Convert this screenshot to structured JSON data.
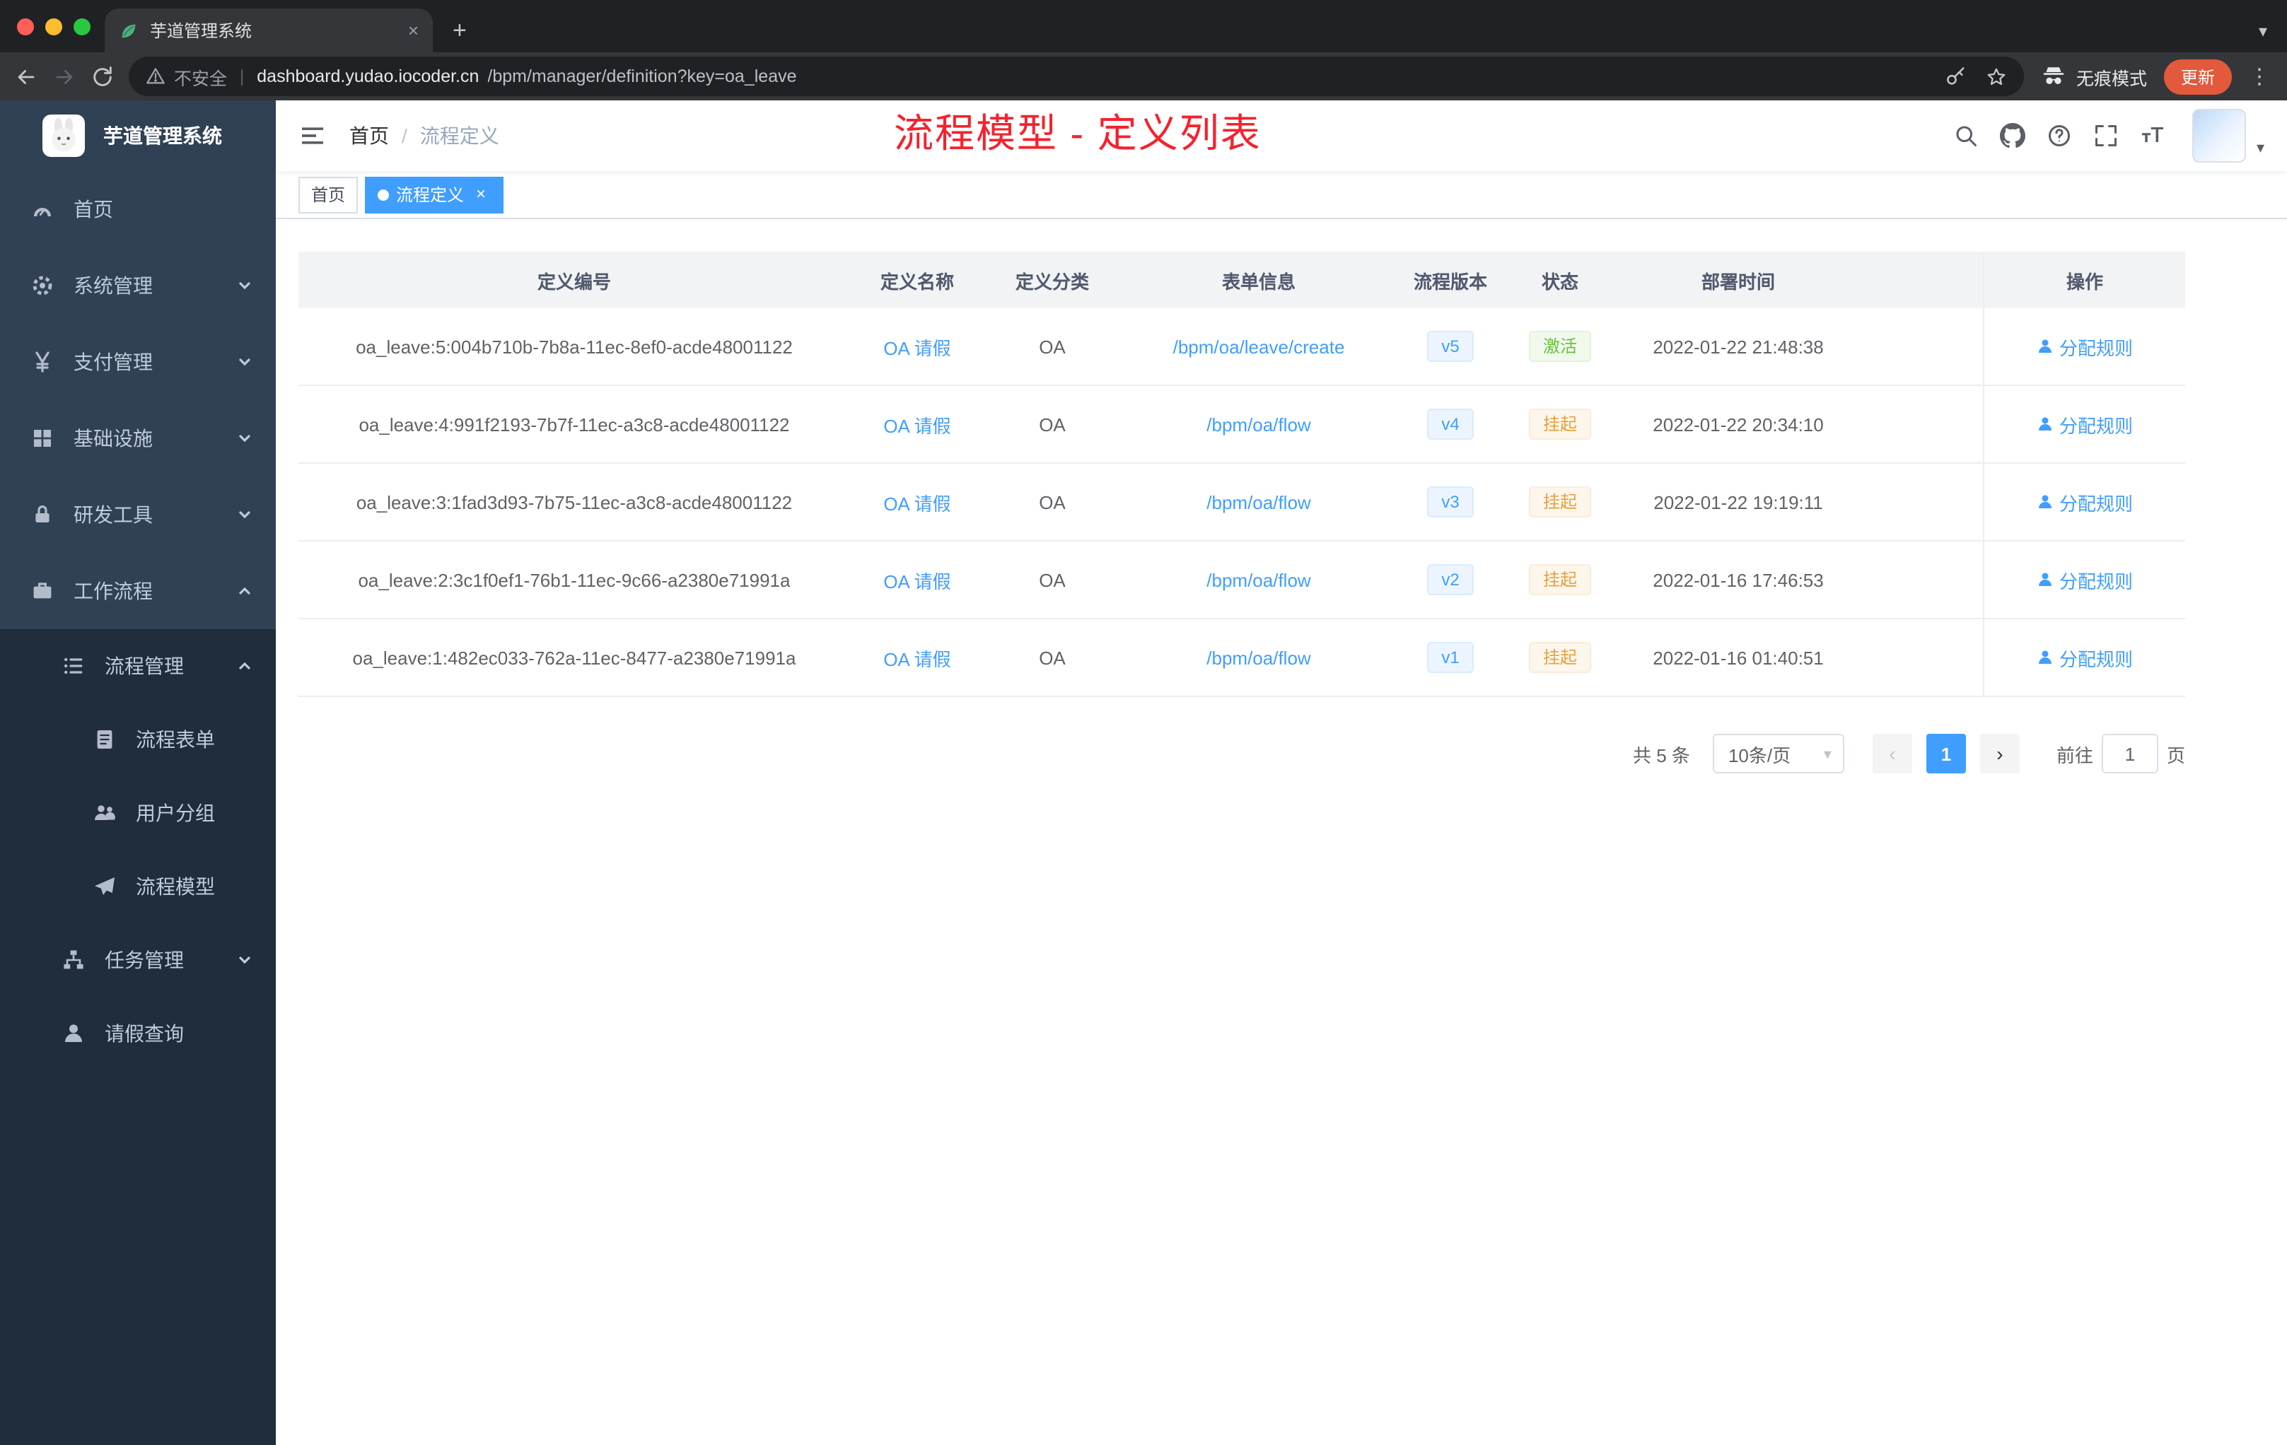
{
  "colors": {
    "accent": "#409eff",
    "success": "#67c23a",
    "warning": "#e6a23c",
    "annotation_red": "#f5222d",
    "sidebar_bg": "#304156",
    "sidebar_sub_bg": "#1f2d3d"
  },
  "icons": {
    "close": "×",
    "plus": "+",
    "caret_down": "▾",
    "more_vertical": "⋮",
    "prev": "‹",
    "next": "›",
    "url_divider": "|"
  },
  "browser": {
    "tab": {
      "title": "芋道管理系统"
    },
    "address": {
      "security_label": "不安全",
      "url_domain": "dashboard.yudao.iocoder.cn",
      "url_path": "/bpm/manager/definition?key=oa_leave",
      "incognito_label": "无痕模式",
      "update_label": "更新"
    }
  },
  "sidebar": {
    "app_title": "芋道管理系统",
    "items": [
      {
        "label": "首页"
      },
      {
        "label": "系统管理"
      },
      {
        "label": "支付管理"
      },
      {
        "label": "基础设施"
      },
      {
        "label": "研发工具"
      },
      {
        "label": "工作流程"
      }
    ],
    "submenu": {
      "manage": {
        "label": "流程管理"
      },
      "children": [
        {
          "label": "流程表单"
        },
        {
          "label": "用户分组"
        },
        {
          "label": "流程模型"
        }
      ],
      "task": {
        "label": "任务管理"
      },
      "leave": {
        "label": "请假查询"
      }
    }
  },
  "header": {
    "breadcrumb": {
      "home": "首页",
      "separator": "/",
      "current": "流程定义"
    },
    "annotation": "流程模型 - 定义列表"
  },
  "tags": {
    "items": [
      {
        "label": "首页",
        "active": false
      },
      {
        "label": "流程定义",
        "active": true
      }
    ]
  },
  "table": {
    "columns": [
      "定义编号",
      "定义名称",
      "定义分类",
      "表单信息",
      "流程版本",
      "状态",
      "部署时间",
      "操作"
    ],
    "rows": [
      {
        "id": "oa_leave:5:004b710b-7b8a-11ec-8ef0-acde48001122",
        "name": "OA 请假",
        "category": "OA",
        "form": "/bpm/oa/leave/create",
        "version": "v5",
        "status": "激活",
        "deploy_time": "2022-01-22 21:48:38",
        "action": "分配规则"
      },
      {
        "id": "oa_leave:4:991f2193-7b7f-11ec-a3c8-acde48001122",
        "name": "OA 请假",
        "category": "OA",
        "form": "/bpm/oa/flow",
        "version": "v4",
        "status": "挂起",
        "deploy_time": "2022-01-22 20:34:10",
        "action": "分配规则"
      },
      {
        "id": "oa_leave:3:1fad3d93-7b75-11ec-a3c8-acde48001122",
        "name": "OA 请假",
        "category": "OA",
        "form": "/bpm/oa/flow",
        "version": "v3",
        "status": "挂起",
        "deploy_time": "2022-01-22 19:19:11",
        "action": "分配规则"
      },
      {
        "id": "oa_leave:2:3c1f0ef1-76b1-11ec-9c66-a2380e71991a",
        "name": "OA 请假",
        "category": "OA",
        "form": "/bpm/oa/flow",
        "version": "v2",
        "status": "挂起",
        "deploy_time": "2022-01-16 17:46:53",
        "action": "分配规则"
      },
      {
        "id": "oa_leave:1:482ec033-762a-11ec-8477-a2380e71991a",
        "name": "OA 请假",
        "category": "OA",
        "form": "/bpm/oa/flow",
        "version": "v1",
        "status": "挂起",
        "deploy_time": "2022-01-16 01:40:51",
        "action": "分配规则"
      }
    ]
  },
  "pagination": {
    "total": "共 5 条",
    "page_size": "10条/页",
    "prev": "‹",
    "page": "1",
    "next": "›",
    "goto_label": "前往",
    "goto_value": "1",
    "unit": "页"
  }
}
